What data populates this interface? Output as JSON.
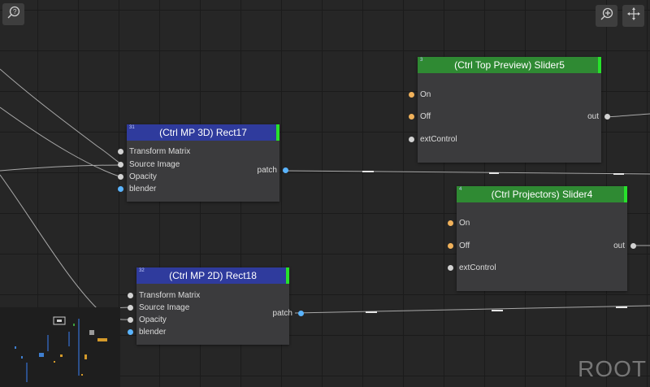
{
  "toolbar": {
    "help_icon": "question-search-icon",
    "zoom_icon": "zoom-in-icon",
    "pan_icon": "move-arrows-icon"
  },
  "nodes": [
    {
      "id": "31",
      "title": "(Ctrl MP 3D) Rect17",
      "header_color": "#2f3b9d",
      "inputs": [
        "Transform Matrix",
        "Source Image",
        "Opacity",
        "blender"
      ],
      "outputs": [
        "patch"
      ]
    },
    {
      "id": "32",
      "title": "(Ctrl MP 2D) Rect18",
      "header_color": "#2f3b9d",
      "inputs": [
        "Transform Matrix",
        "Source Image",
        "Opacity",
        "blender"
      ],
      "outputs": [
        "patch"
      ]
    },
    {
      "id": "3",
      "title": "(Ctrl Top Preview) Slider5",
      "header_color": "#2f8a33",
      "inputs": [
        "On",
        "Off",
        "extControl"
      ],
      "outputs": [
        "out"
      ]
    },
    {
      "id": "4",
      "title": "(Ctrl Projectors) Slider4",
      "header_color": "#2f8a33",
      "inputs": [
        "On",
        "Off",
        "extControl"
      ],
      "outputs": [
        "out"
      ]
    }
  ],
  "root_label": "ROOT"
}
